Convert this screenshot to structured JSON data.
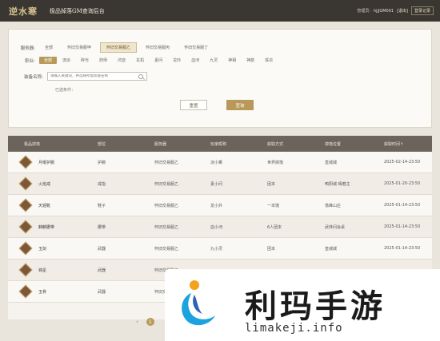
{
  "header": {
    "logo": "逆水寒",
    "title": "极品掉落GM查询后台",
    "user_prefix": "管理员:",
    "user_name": "hjjjGM001",
    "logout": "[退出]",
    "login_record": "登录记录"
  },
  "filters": {
    "server_label": "服务器:",
    "servers": [
      "全部",
      "怀旧交易服甲",
      "怀旧交易服乙",
      "怀旧交易服丙",
      "怀旧交易服丁"
    ],
    "server_selected": 2,
    "class_label": "职业:",
    "classes": [
      "全部",
      "流派",
      "碎光",
      "药师",
      "鸿音",
      "玄机",
      "素问",
      "龙吟",
      "血河",
      "九灵",
      "神相",
      "神鹊",
      "铁衣"
    ],
    "class_selected": 0,
    "item_label": "装备名称:",
    "item_placeholder": "请输入关键词，并选择所需装备名称",
    "selected_conditions": "已选条件：",
    "reset_label": "重置",
    "query_label": "查询"
  },
  "table": {
    "headers": [
      "极品掉落",
      "部位",
      "服务器",
      "玩家昵称",
      "获取方式",
      "掉落位置",
      "获取时间↑"
    ],
    "rows": [
      {
        "name": "月曜护腕",
        "part": "护腕",
        "server": "怀旧交易服乙",
        "player": "凉小乘",
        "method": "世界掉落",
        "location": "皇城城",
        "time": "2025-02-14-23:50"
      },
      {
        "name": "火焰戒",
        "part": "戒指",
        "server": "怀旧交易服乙",
        "player": "素小问",
        "method": "团本",
        "location": "鸭阳城·晴春主",
        "time": "2025-01-20-23:50"
      },
      {
        "name": "天遁靴",
        "part": "鞋子",
        "server": "怀旧交易服乙",
        "player": "龙小外",
        "method": "一本馆",
        "location": "落峰山庄",
        "time": "2025-01-14-23:50"
      },
      {
        "name": "麒麟腰带",
        "part": "腰带",
        "server": "怀旧交易服乙",
        "player": "血小河",
        "method": "6人团本",
        "location": "武林问会桌",
        "time": "2025-01-14-23:50"
      },
      {
        "name": "玉剑",
        "part": "武器",
        "server": "怀旧交易服乙",
        "player": "九小灵",
        "method": "团本",
        "location": "皇城城",
        "time": "2025-01-14-23:50"
      },
      {
        "name": "锦星",
        "part": "武器",
        "server": "怀旧交易服乙",
        "player": "",
        "method": "",
        "location": "",
        "time": ""
      },
      {
        "name": "玉骨",
        "part": "武器",
        "server": "怀旧交易服乙",
        "player": "",
        "method": "",
        "location": "",
        "time": ""
      }
    ]
  },
  "pager": {
    "prev": "‹",
    "current": "1"
  },
  "watermark": {
    "title": "利玛手游",
    "url": "limakeji.info"
  }
}
